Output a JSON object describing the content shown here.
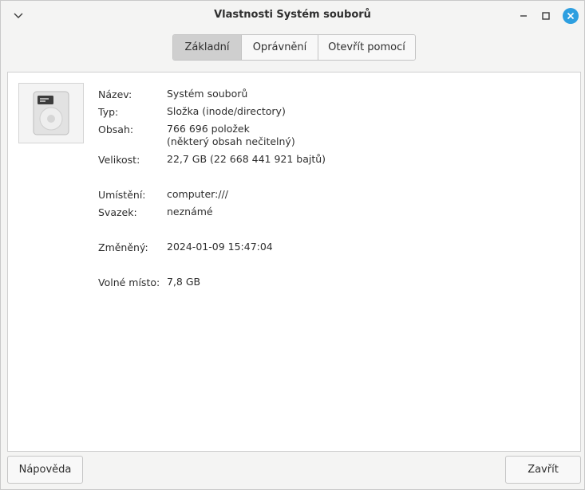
{
  "window": {
    "title": "Vlastnosti Systém souborů"
  },
  "tabs": [
    {
      "label": "Základní",
      "active": true
    },
    {
      "label": "Oprávnění",
      "active": false
    },
    {
      "label": "Otevřít pomocí",
      "active": false
    }
  ],
  "icon": "harddisk-icon",
  "properties": {
    "name_label": "Název:",
    "name_value": "Systém souborů",
    "type_label": "Typ:",
    "type_value": "Složka (inode/directory)",
    "contents_label": "Obsah:",
    "contents_value": "766 696 položek",
    "contents_note": "(některý obsah nečitelný)",
    "size_label": "Velikost:",
    "size_value": "22,7 GB (22 668 441 921 bajtů)",
    "location_label": "Umístění:",
    "location_value": "computer:///",
    "volume_label": "Svazek:",
    "volume_value": "neznámé",
    "modified_label": "Změněný:",
    "modified_value": "2024-01-09 15:47:04",
    "free_label": "Volné místo:",
    "free_value": "7,8 GB"
  },
  "buttons": {
    "help": "Nápověda",
    "close": "Zavřít"
  },
  "colors": {
    "close_button": "#2d9fe0",
    "active_tab": "#cfcfcf"
  }
}
